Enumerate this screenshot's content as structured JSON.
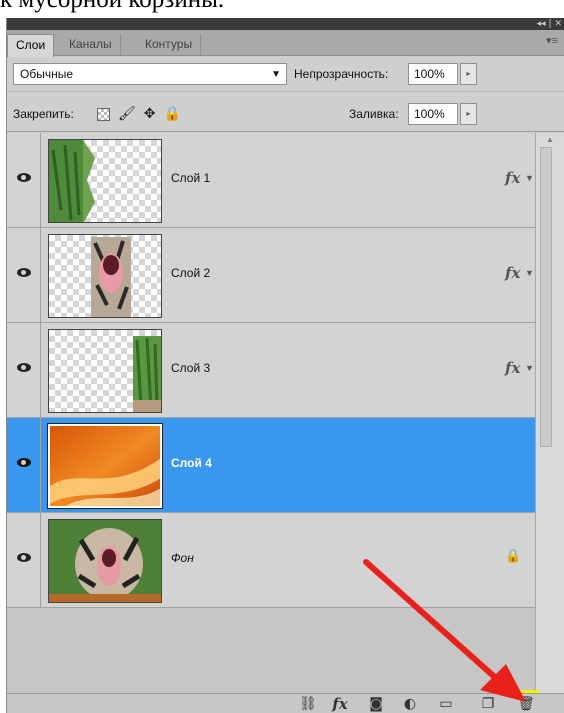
{
  "caption": "к мусорной корзины.",
  "window_controls": "◂◂ | ✕",
  "tabs": [
    {
      "label": "Слои",
      "active": true
    },
    {
      "label": "Каналы",
      "active": false
    },
    {
      "label": "Контуры",
      "active": false
    }
  ],
  "panel_menu_icon": "▾≡",
  "blend_mode": {
    "value": "Обычные",
    "caret": "▼"
  },
  "opacity": {
    "label": "Непрозрачность:",
    "value": "100%",
    "spin": "▸"
  },
  "lock": {
    "label": "Закрепить:",
    "icons": [
      "transparency-lock-icon",
      "brush-lock-icon",
      "move-lock-icon",
      "padlock-icon"
    ]
  },
  "fill": {
    "label": "Заливка:",
    "value": "100%",
    "spin": "▸"
  },
  "layers": [
    {
      "name": "Слой 1",
      "fx": "fx",
      "selected": false,
      "locked": false
    },
    {
      "name": "Слой 2",
      "fx": "fx",
      "selected": false,
      "locked": false
    },
    {
      "name": "Слой 3",
      "fx": "fx",
      "selected": false,
      "locked": false
    },
    {
      "name": "Слой 4",
      "fx": "",
      "selected": true,
      "locked": false
    },
    {
      "name": "Фон",
      "fx": "",
      "selected": false,
      "locked": true
    }
  ],
  "fx_arrow": "▼",
  "bottom_icons": [
    "link-icon",
    "fx-icon",
    "mask-icon",
    "adjustment-icon",
    "group-icon",
    "new-layer-icon",
    "trash-icon"
  ],
  "fx_glyph": "fx",
  "lock_glyph": "🔒",
  "colors": {
    "selection": "#3a97ee",
    "highlight": "#f3f000",
    "arrow": "#e8211b"
  }
}
